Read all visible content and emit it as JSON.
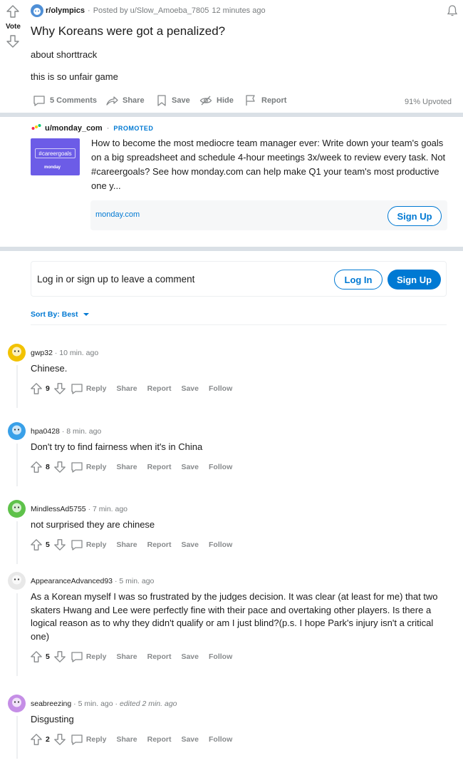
{
  "post": {
    "subreddit": "r/olympics",
    "posted_by": "Posted by u/Slow_Amoeba_7805",
    "time": "12 minutes ago",
    "vote_label": "Vote",
    "title": "Why Koreans were got a penalized?",
    "body_lines": [
      "about shorttrack",
      "this is so unfair game"
    ],
    "actions": {
      "comments": "5 Comments",
      "share": "Share",
      "save": "Save",
      "hide": "Hide",
      "report": "Report"
    },
    "upvoted": "91% Upvoted"
  },
  "ad": {
    "user": "u/monday_com",
    "promoted": "PROMOTED",
    "thumb_tag": "#careergoals",
    "thumb_brand": "monday",
    "text": "How to become the most mediocre team manager ever: Write down your team's goals on a big spreadsheet and schedule 4-hour meetings 3x/week to review every task. Not #careergoals? See how monday.com can help make Q1 your team's most productive one y...",
    "link": "monday.com",
    "cta": "Sign Up"
  },
  "comment_box": {
    "prompt": "Log in or sign up to leave a comment",
    "login": "Log In",
    "signup": "Sign Up"
  },
  "sort": {
    "label": "Sort By: Best"
  },
  "comment_actions": {
    "reply": "Reply",
    "share": "Share",
    "report": "Report",
    "save": "Save",
    "follow": "Follow"
  },
  "comments": [
    {
      "user": "gwp32",
      "time": "10 min. ago",
      "edited": "",
      "text": "Chinese.",
      "score": "9",
      "avatar_color": "#f2c200"
    },
    {
      "user": "hpa0428",
      "time": "8 min. ago",
      "edited": "",
      "text": "Don't try to find fairness when it's in China",
      "score": "8",
      "avatar_color": "#39a0e8"
    },
    {
      "user": "MindlessAd5755",
      "time": "7 min. ago",
      "edited": "",
      "text": "not surprised they are chinese",
      "score": "5",
      "avatar_color": "#5ec24a"
    },
    {
      "user": "AppearanceAdvanced93",
      "time": "5 min. ago",
      "edited": "",
      "text": "As a Korean myself I was so frustrated by the judges decision. It was clear (at least for me) that two skaters Hwang and Lee were perfectly fine with their pace and overtaking other players. Is there a logical reason as to why they didn't qualify or am I just blind?(p.s. I hope Park's injury isn't a critical one)",
      "score": "5",
      "avatar_color": "#e8e8e8"
    },
    {
      "user": "seabreezing",
      "time": "5 min. ago",
      "edited": "edited 2 min. ago",
      "text": "Disgusting",
      "score": "2",
      "avatar_color": "#c58ee6"
    }
  ],
  "colors": {
    "accent": "#0079d3",
    "muted": "#787c7e",
    "background": "#dae0e6"
  }
}
